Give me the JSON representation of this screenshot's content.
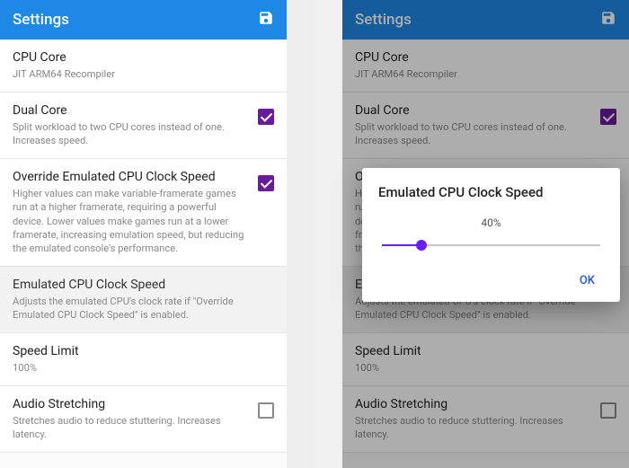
{
  "header": {
    "title": "Settings",
    "save_icon": "save-icon"
  },
  "items": {
    "cpu_core": {
      "title": "CPU Core",
      "sub": "JIT ARM64 Recompiler"
    },
    "dual_core": {
      "title": "Dual Core",
      "sub": "Split workload to two CPU cores instead of one. Increases speed.",
      "checked": true
    },
    "override_clock": {
      "title": "Override Emulated CPU Clock Speed",
      "sub": "Higher values can make variable-framerate games run at a higher framerate, requiring a powerful device. Lower values make games run at a lower framerate, increasing emulation speed, but reducing the emulated console's performance.",
      "checked": true
    },
    "emulated_clock": {
      "title": "Emulated CPU Clock Speed",
      "sub": "Adjusts the emulated CPU's clock rate if \"Override Emulated CPU Clock Speed\" is enabled."
    },
    "speed_limit": {
      "title": "Speed Limit",
      "sub": "100%"
    },
    "audio_stretching": {
      "title": "Audio Stretching",
      "sub": "Stretches audio to reduce stuttering. Increases latency.",
      "checked": false
    }
  },
  "dialog": {
    "title": "Emulated CPU Clock Speed",
    "value_label": "40%",
    "value_percent": 18,
    "ok_label": "OK"
  }
}
